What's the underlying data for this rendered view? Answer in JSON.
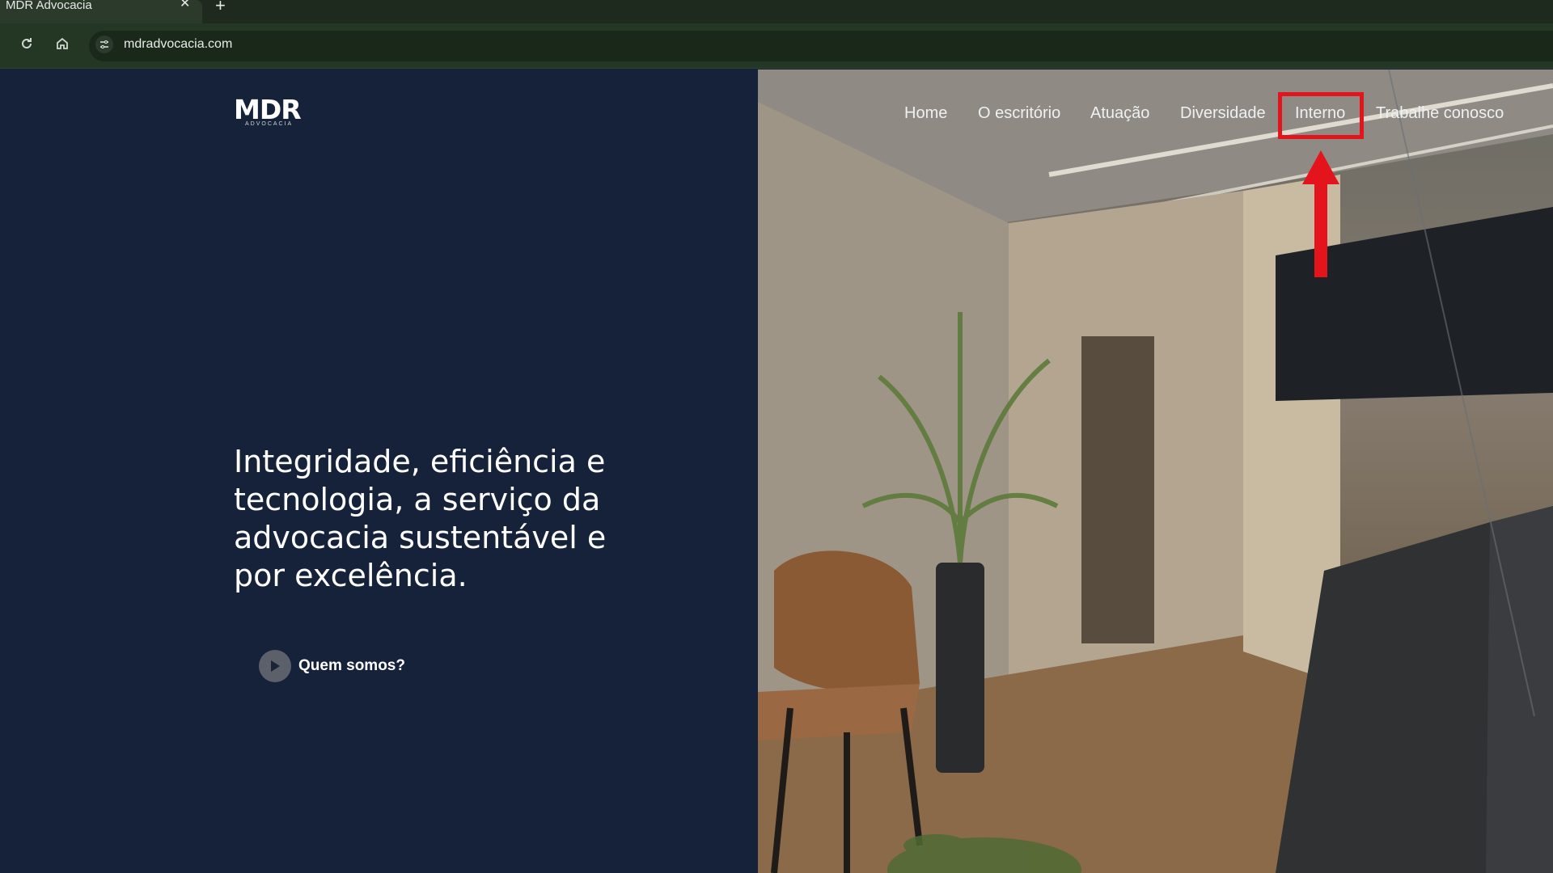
{
  "browser": {
    "tab_title": "MDR Advocacia",
    "tab_close": "✕",
    "new_tab": "+",
    "url": "mdradvocacia.com"
  },
  "logo": {
    "main": "MDR",
    "sub": "ADVOCACIA"
  },
  "nav": {
    "items": [
      "Home",
      "O escritório",
      "Atuação",
      "Diversidade",
      "Interno",
      "Trabalhe conosco"
    ]
  },
  "hero": {
    "headline": "Integridade, eficiência e tecnologia, a serviço da advocacia sustentável e por excelência.",
    "cta_label": "Quem somos?"
  },
  "annotation": {
    "highlight_color": "#e3141b"
  }
}
